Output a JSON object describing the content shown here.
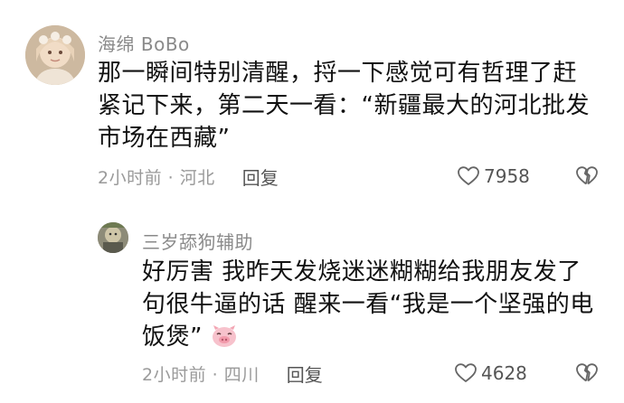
{
  "comments": [
    {
      "username": "海绵 BoBo",
      "content_lines": [
        "那一瞬间特别清醒，捋一下感觉可有哲理了赶",
        "紧记下来，第二天一看：“新疆最大的河北批发",
        "市场在西藏”"
      ],
      "meta": "2小时前 · 河北",
      "reply_label": "回复",
      "like_count": "7958"
    },
    {
      "username": "三岁舔狗辅助",
      "content_lines": [
        "好厉害  我昨天发烧迷迷糊糊给我朋友发了",
        "句很牛逼的话  醒来一看“我是一个坚强的电",
        "饭煲”"
      ],
      "meta": "2小时前 · 四川",
      "reply_label": "回复",
      "like_count": "4628"
    }
  ],
  "colors": {
    "username": "#8a8a8a",
    "content": "#111111",
    "meta": "#9a9a9a",
    "action": "#555555",
    "pig_emoji": "#f3a6b4"
  },
  "icons": {
    "like": "heart-outline-icon",
    "dislike": "broken-heart-icon",
    "emoji": "pig-face-emoji"
  }
}
